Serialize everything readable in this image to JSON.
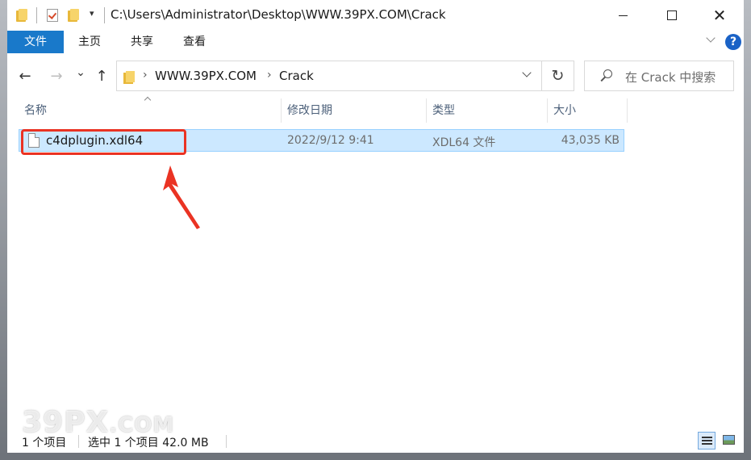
{
  "titlebar": {
    "path": "C:\\Users\\Administrator\\Desktop\\WWW.39PX.COM\\Crack",
    "dropdown_glyph": "▾",
    "close_glyph": "✕"
  },
  "ribbon": {
    "tabs": [
      {
        "label": "文件"
      },
      {
        "label": "主页"
      },
      {
        "label": "共享"
      },
      {
        "label": "查看"
      }
    ],
    "help": "?"
  },
  "nav": {
    "back_glyph": "←",
    "forward_glyph": "→",
    "recent_glyph": "⌄",
    "up_glyph": "↑",
    "breadcrumbs": [
      "WWW.39PX.COM",
      "Crack"
    ],
    "crumb_sep": "›",
    "refresh_glyph": "↻",
    "search_placeholder": "在 Crack 中搜索"
  },
  "columns": {
    "name": "名称",
    "modified": "修改日期",
    "type": "类型",
    "size": "大小"
  },
  "files": [
    {
      "name": "c4dplugin.xdl64",
      "modified": "2022/9/12 9:41",
      "type": "XDL64 文件",
      "size": "43,035 KB",
      "selected": true
    }
  ],
  "status": {
    "count": "1 个项目",
    "selected": "选中 1 个项目  42.0 MB"
  },
  "watermark": {
    "main": "39PX",
    "suffix": ".COM"
  },
  "colors": {
    "accent": "#1979ca",
    "selection": "#cce8ff",
    "annotation": "#ea3323"
  },
  "icons": [
    "folder-icon",
    "checkmark-icon",
    "file-icon",
    "search-icon",
    "refresh-icon",
    "help-icon",
    "details-view-icon",
    "large-icons-view-icon"
  ]
}
